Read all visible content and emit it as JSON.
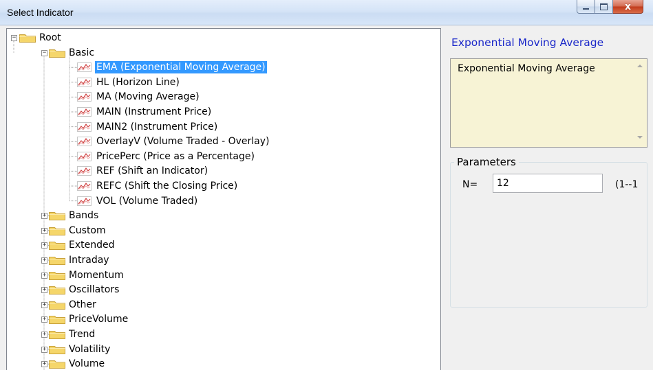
{
  "window": {
    "title": "Select Indicator",
    "controls": {
      "minimize": "minimize",
      "maximize": "maximize",
      "close": "x"
    }
  },
  "tree": {
    "root": "Root",
    "expanded_folder": "Basic",
    "selected": "EMA (Exponential Moving Average)",
    "basic_items": [
      "EMA (Exponential Moving Average)",
      "HL (Horizon Line)",
      "MA (Moving Average)",
      "MAIN (Instrument Price)",
      "MAIN2 (Instrument Price)",
      "OverlayV (Volume Traded - Overlay)",
      "PricePerc (Price as a Percentage)",
      "REF (Shift an Indicator)",
      "REFC (Shift the Closing Price)",
      "VOL (Volume Traded)"
    ],
    "collapsed_folders": [
      "Bands",
      "Custom",
      "Extended",
      "Intraday",
      "Momentum",
      "Oscillators",
      "Other",
      "PriceVolume",
      "Trend",
      "Volatility",
      "Volume"
    ],
    "expand_glyph": "+",
    "collapse_glyph": "−",
    "folder_color": "#f5d66a",
    "selection_color": "#3399ff"
  },
  "details": {
    "title": "Exponential Moving Average",
    "description": "Exponential Moving Average",
    "parameters_label": "Parameters",
    "params": [
      {
        "label": "N=",
        "value": "12",
        "range": "(1--1"
      }
    ],
    "title_color": "#1a27c9",
    "description_bg": "#f7f3d5"
  }
}
